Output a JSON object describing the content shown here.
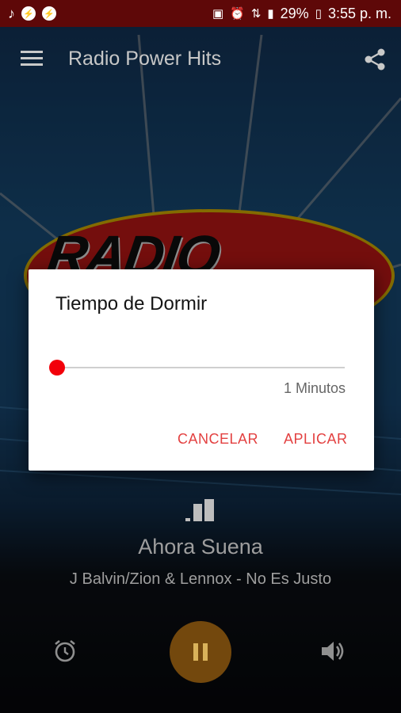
{
  "status_bar": {
    "left_icons": [
      "music-note-icon",
      "messenger-icon",
      "messenger-icon"
    ],
    "right_icons": [
      "robot-icon",
      "alarm-icon",
      "network-icon",
      "signal-icon",
      "battery-icon"
    ],
    "battery": "29%",
    "time": "3:55 p. m."
  },
  "app_bar": {
    "title": "Radio Power Hits"
  },
  "artwork": {
    "logo_text": "RADIO"
  },
  "now_playing": {
    "label": "Ahora Suena",
    "track": "J Balvin/Zion & Lennox - No Es Justo"
  },
  "sleep_dialog": {
    "title": "Tiempo de Dormir",
    "value_text": "1 Minutos",
    "slider_fraction": 0,
    "cancel_label": "CANCELAR",
    "apply_label": "APLICAR"
  },
  "colors": {
    "status_bar": "#5e0808",
    "accent_red": "#f2000a",
    "dialog_button": "#e34141",
    "play_button": "#73480d"
  }
}
